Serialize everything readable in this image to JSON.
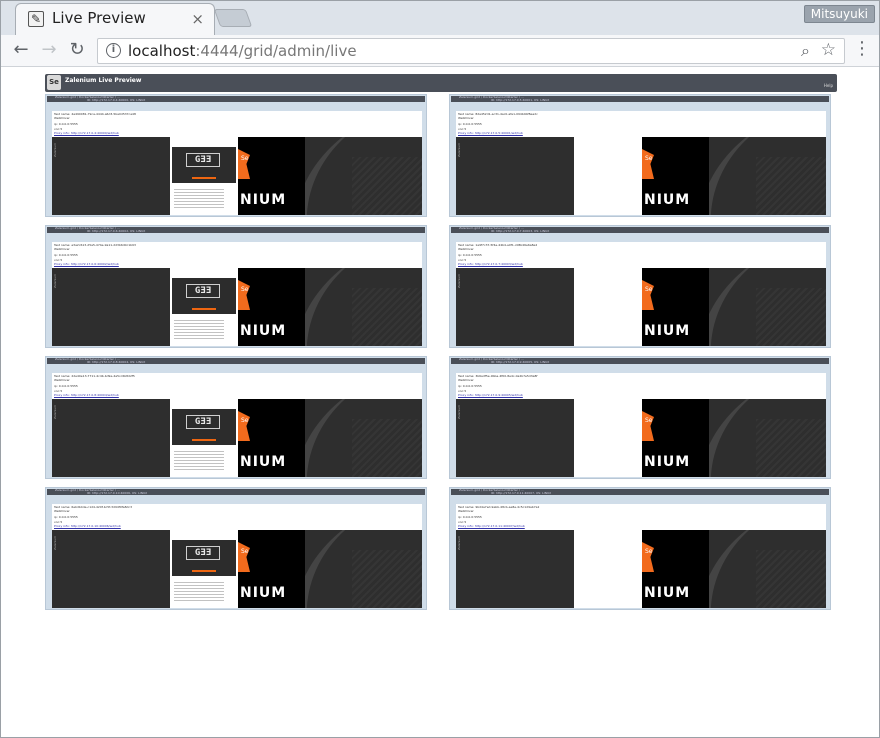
{
  "browser": {
    "tab_title": "Live Preview",
    "tab_close": "×",
    "profile_name": "Mitsuyuki",
    "nav": {
      "back": "←",
      "forward": "→",
      "reload": "↻",
      "menu": "⋮"
    },
    "url_host": "localhost",
    "url_rest": ":4444/grid/admin/live",
    "icons": [
      "info-icon",
      "zoom-icon",
      "star-icon"
    ]
  },
  "page": {
    "header_title": "Zalenium Live Preview",
    "header_logo": "Se",
    "help_text": "Help"
  },
  "tiles": [
    {
      "bar1": "Zalenium-grid / DockerSeleniumStarter / ...",
      "bar2": "ID: http://172.17.0.4:40000, OS: LINUX",
      "tab1": "Screenshots",
      "tab2": "Configuration",
      "test_name": "Test name: 4a490081-79ca-4444-a6d3-5ba0d537ca48",
      "browser": "WebDriver",
      "ip": "ip: 0.0.0.0:5555",
      "vnc": "vnc:5",
      "link": "Proxy info: http://172.17.0.4:40000/wd/hub",
      "content": "grid"
    },
    {
      "bar1": "Zalenium-grid / DockerSeleniumStarter / ...",
      "bar2": "ID: http://172.17.0.5:40001, OS: LINUX",
      "tab1": "Screenshots",
      "tab2": "Configuration",
      "test_name": "Test name: 8da452d1-ac31-4ac0-afe1-094b4bf8ea2c",
      "browser": "WebDriver",
      "ip": "ip: 0.0.0.0:5555",
      "vnc": "vnc:5",
      "link": "Proxy info: http://172.17.0.5:40001/wd/hub",
      "content": "blank"
    },
    {
      "bar1": "Zalenium-grid / DockerSeleniumStarter / ...",
      "bar2": "ID: http://172.17.0.6:40002, OS: LINUX",
      "tab1": "Screenshots",
      "tab2": "Configuration",
      "test_name": "Test name: e3a2c613-d5a5-474e-9a11-2d3b6d0c1b93",
      "browser": "WebDriver",
      "ip": "ip: 0.0.0.0:5555",
      "vnc": "vnc:5",
      "link": "Proxy info: http://172.17.0.6:40002/wd/hub",
      "content": "grid"
    },
    {
      "bar1": "Zalenium-grid / DockerSeleniumStarter / ...",
      "bar2": "ID: http://172.17.0.7:40003, OS: LINUX",
      "tab1": "Screenshots",
      "tab2": "Configuration",
      "test_name": "Test name: 1a9f7c37-5f4e-44b4-a0f1-c08b46e6a8e2",
      "browser": "WebDriver",
      "ip": "ip: 0.0.0.0:5555",
      "vnc": "vnc:5",
      "link": "Proxy info: http://172.17.0.7:40003/wd/hub",
      "content": "blank"
    },
    {
      "bar1": "Zalenium-grid / DockerSeleniumStarter / ...",
      "bar2": "ID: http://172.17.0.8:40004, OS: LINUX",
      "tab1": "Screenshots",
      "tab2": "Configuration",
      "test_name": "Test name: 2de40e13-7711-4c4b-bd9e-4a5cc6b8d2f5",
      "browser": "WebDriver",
      "ip": "ip: 0.0.0.0:5555",
      "vnc": "vnc:5",
      "link": "Proxy info: http://172.17.0.8:40004/wd/hub",
      "content": "grid"
    },
    {
      "bar1": "Zalenium-grid / DockerSeleniumStarter / ...",
      "bar2": "ID: http://172.17.0.9:40005, OS: LINUX",
      "tab1": "Screenshots",
      "tab2": "Configuration",
      "test_name": "Test name: 3b6adf5e-9bba-4f00-8e4c-0a2b7e5d3a8f",
      "browser": "WebDriver",
      "ip": "ip: 0.0.0.0:5555",
      "vnc": "vnc:5",
      "link": "Proxy info: http://172.17.0.9:40005/wd/hub",
      "content": "blank"
    },
    {
      "bar1": "Zalenium-grid / DockerSeleniumStarter / ...",
      "bar2": "ID: http://172.17.0.10:40006, OS: LINUX",
      "tab1": "Screenshots",
      "tab2": "Configuration",
      "test_name": "Test name: 6ebdb4de-c1d4-420f-bc5f-3d94f0fa8dc3",
      "browser": "WebDriver",
      "ip": "ip: 0.0.0.0:5555",
      "vnc": "vnc:5",
      "link": "Proxy info: http://172.17.0.10:40006/wd/hub",
      "content": "grid"
    },
    {
      "bar1": "Zalenium-grid / DockerSeleniumStarter / ...",
      "bar2": "ID: http://172.17.0.11:40007, OS: LINUX",
      "tab1": "Screenshots",
      "tab2": "Configuration",
      "test_name": "Test name: 9bd4a7ed-9ebb-48cb-ae8e-4c5c1d9ab7a2",
      "browser": "WebDriver",
      "ip": "ip: 0.0.0.0:5555",
      "vnc": "vnc:5",
      "link": "Proxy info: http://172.17.0.11:40007/wd/hub",
      "content": "blank"
    }
  ],
  "screenshot": {
    "grid_logo": "GƎƎ",
    "brand": "NIUM",
    "vertical_label": "Zalenium"
  }
}
